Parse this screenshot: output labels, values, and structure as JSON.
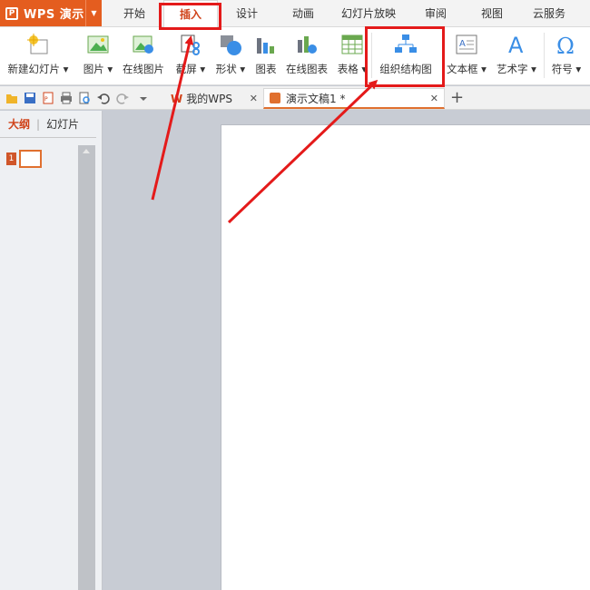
{
  "app": {
    "logo": "P",
    "name": "WPS 演示"
  },
  "menu_tabs": [
    "开始",
    "插入",
    "设计",
    "动画",
    "幻灯片放映",
    "审阅",
    "视图",
    "云服务"
  ],
  "ribbon": {
    "new_slide": "新建幻灯片",
    "picture": "图片",
    "online_picture": "在线图片",
    "screenshot": "截屏",
    "shape": "形状",
    "chart": "图表",
    "online_chart": "在线图表",
    "table": "表格",
    "org_chart": "组织结构图",
    "textbox": "文本框",
    "wordart": "艺术字",
    "symbol": "符号"
  },
  "doc_tabs": [
    {
      "label": "我的WPS"
    },
    {
      "label": "演示文稿1 *"
    }
  ],
  "left_pane": {
    "outline_tab": "大纲",
    "slides_tab": "幻灯片",
    "slide_number": "1"
  },
  "colors": {
    "accent": "#e45d1f",
    "annotation": "#e41a1a"
  }
}
